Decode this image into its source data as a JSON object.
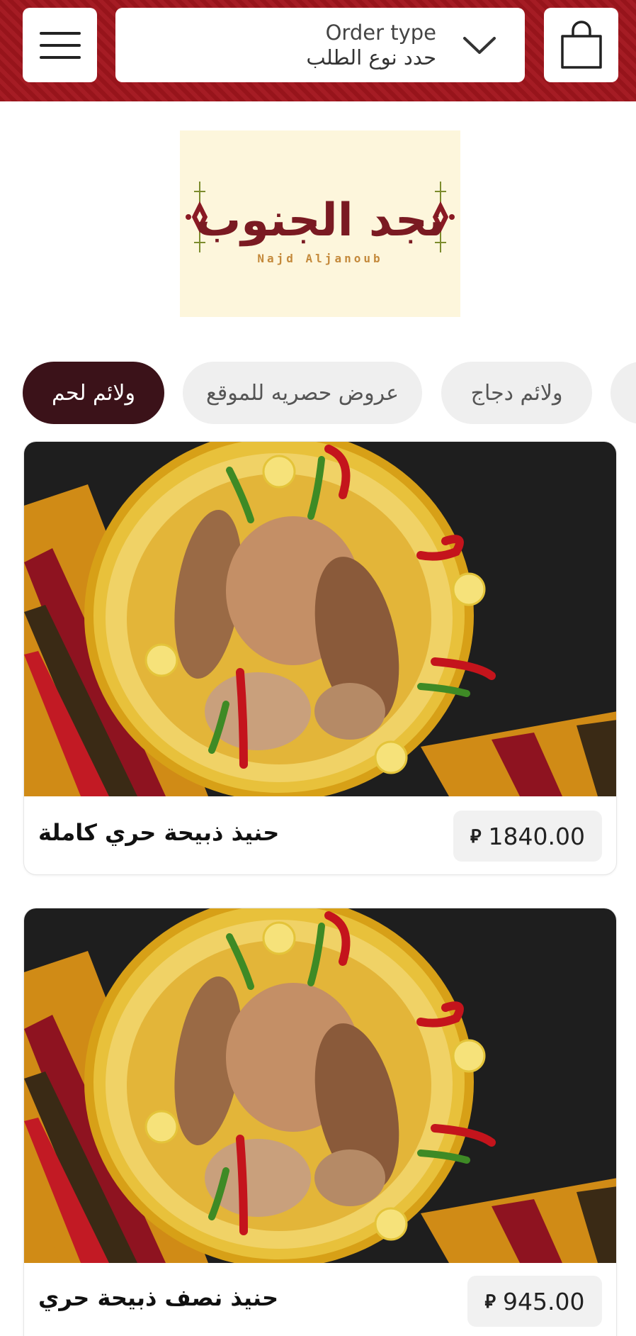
{
  "header": {
    "order_type_title": "Order type",
    "order_type_subtitle": "حدد نوع الطلب",
    "icons": {
      "menu": "hamburger-menu-icon",
      "dropdown": "chevron-down-icon",
      "cart": "shopping-bag-icon"
    }
  },
  "logo": {
    "arabic": "نجد الجنوب",
    "latin": "Najd Aljanoub"
  },
  "tabs": [
    {
      "label": "ولائم لحم",
      "active": true
    },
    {
      "label": "عروض حصريه للموقع",
      "active": false
    },
    {
      "label": "ولائم دجاج",
      "active": false
    }
  ],
  "products": [
    {
      "name": "حنيذ ذبيحة حري كاملة",
      "price": "1840.00",
      "currency_symbol": "⃁"
    },
    {
      "name": "حنيذ نصف ذبيحة حري",
      "price": "945.00",
      "currency_symbol": "⃁"
    }
  ],
  "colors": {
    "header": "#a2151d",
    "active_tab": "#3b1219",
    "tab_bg": "#efefef",
    "logo_bg": "#fdf6dc"
  }
}
